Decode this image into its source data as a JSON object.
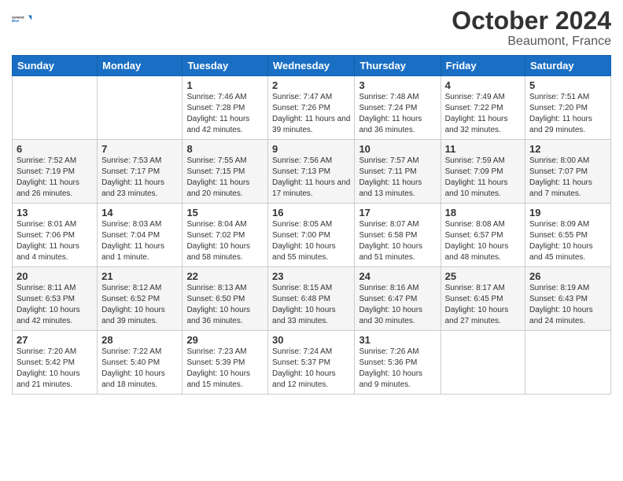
{
  "header": {
    "logo_general": "General",
    "logo_blue": "Blue",
    "month_title": "October 2024",
    "location": "Beaumont, France"
  },
  "days_of_week": [
    "Sunday",
    "Monday",
    "Tuesday",
    "Wednesday",
    "Thursday",
    "Friday",
    "Saturday"
  ],
  "weeks": [
    [
      {
        "day": "",
        "sunrise": "",
        "sunset": "",
        "daylight": ""
      },
      {
        "day": "",
        "sunrise": "",
        "sunset": "",
        "daylight": ""
      },
      {
        "day": "1",
        "sunrise": "Sunrise: 7:46 AM",
        "sunset": "Sunset: 7:28 PM",
        "daylight": "Daylight: 11 hours and 42 minutes."
      },
      {
        "day": "2",
        "sunrise": "Sunrise: 7:47 AM",
        "sunset": "Sunset: 7:26 PM",
        "daylight": "Daylight: 11 hours and 39 minutes."
      },
      {
        "day": "3",
        "sunrise": "Sunrise: 7:48 AM",
        "sunset": "Sunset: 7:24 PM",
        "daylight": "Daylight: 11 hours and 36 minutes."
      },
      {
        "day": "4",
        "sunrise": "Sunrise: 7:49 AM",
        "sunset": "Sunset: 7:22 PM",
        "daylight": "Daylight: 11 hours and 32 minutes."
      },
      {
        "day": "5",
        "sunrise": "Sunrise: 7:51 AM",
        "sunset": "Sunset: 7:20 PM",
        "daylight": "Daylight: 11 hours and 29 minutes."
      }
    ],
    [
      {
        "day": "6",
        "sunrise": "Sunrise: 7:52 AM",
        "sunset": "Sunset: 7:19 PM",
        "daylight": "Daylight: 11 hours and 26 minutes."
      },
      {
        "day": "7",
        "sunrise": "Sunrise: 7:53 AM",
        "sunset": "Sunset: 7:17 PM",
        "daylight": "Daylight: 11 hours and 23 minutes."
      },
      {
        "day": "8",
        "sunrise": "Sunrise: 7:55 AM",
        "sunset": "Sunset: 7:15 PM",
        "daylight": "Daylight: 11 hours and 20 minutes."
      },
      {
        "day": "9",
        "sunrise": "Sunrise: 7:56 AM",
        "sunset": "Sunset: 7:13 PM",
        "daylight": "Daylight: 11 hours and 17 minutes."
      },
      {
        "day": "10",
        "sunrise": "Sunrise: 7:57 AM",
        "sunset": "Sunset: 7:11 PM",
        "daylight": "Daylight: 11 hours and 13 minutes."
      },
      {
        "day": "11",
        "sunrise": "Sunrise: 7:59 AM",
        "sunset": "Sunset: 7:09 PM",
        "daylight": "Daylight: 11 hours and 10 minutes."
      },
      {
        "day": "12",
        "sunrise": "Sunrise: 8:00 AM",
        "sunset": "Sunset: 7:07 PM",
        "daylight": "Daylight: 11 hours and 7 minutes."
      }
    ],
    [
      {
        "day": "13",
        "sunrise": "Sunrise: 8:01 AM",
        "sunset": "Sunset: 7:06 PM",
        "daylight": "Daylight: 11 hours and 4 minutes."
      },
      {
        "day": "14",
        "sunrise": "Sunrise: 8:03 AM",
        "sunset": "Sunset: 7:04 PM",
        "daylight": "Daylight: 11 hours and 1 minute."
      },
      {
        "day": "15",
        "sunrise": "Sunrise: 8:04 AM",
        "sunset": "Sunset: 7:02 PM",
        "daylight": "Daylight: 10 hours and 58 minutes."
      },
      {
        "day": "16",
        "sunrise": "Sunrise: 8:05 AM",
        "sunset": "Sunset: 7:00 PM",
        "daylight": "Daylight: 10 hours and 55 minutes."
      },
      {
        "day": "17",
        "sunrise": "Sunrise: 8:07 AM",
        "sunset": "Sunset: 6:58 PM",
        "daylight": "Daylight: 10 hours and 51 minutes."
      },
      {
        "day": "18",
        "sunrise": "Sunrise: 8:08 AM",
        "sunset": "Sunset: 6:57 PM",
        "daylight": "Daylight: 10 hours and 48 minutes."
      },
      {
        "day": "19",
        "sunrise": "Sunrise: 8:09 AM",
        "sunset": "Sunset: 6:55 PM",
        "daylight": "Daylight: 10 hours and 45 minutes."
      }
    ],
    [
      {
        "day": "20",
        "sunrise": "Sunrise: 8:11 AM",
        "sunset": "Sunset: 6:53 PM",
        "daylight": "Daylight: 10 hours and 42 minutes."
      },
      {
        "day": "21",
        "sunrise": "Sunrise: 8:12 AM",
        "sunset": "Sunset: 6:52 PM",
        "daylight": "Daylight: 10 hours and 39 minutes."
      },
      {
        "day": "22",
        "sunrise": "Sunrise: 8:13 AM",
        "sunset": "Sunset: 6:50 PM",
        "daylight": "Daylight: 10 hours and 36 minutes."
      },
      {
        "day": "23",
        "sunrise": "Sunrise: 8:15 AM",
        "sunset": "Sunset: 6:48 PM",
        "daylight": "Daylight: 10 hours and 33 minutes."
      },
      {
        "day": "24",
        "sunrise": "Sunrise: 8:16 AM",
        "sunset": "Sunset: 6:47 PM",
        "daylight": "Daylight: 10 hours and 30 minutes."
      },
      {
        "day": "25",
        "sunrise": "Sunrise: 8:17 AM",
        "sunset": "Sunset: 6:45 PM",
        "daylight": "Daylight: 10 hours and 27 minutes."
      },
      {
        "day": "26",
        "sunrise": "Sunrise: 8:19 AM",
        "sunset": "Sunset: 6:43 PM",
        "daylight": "Daylight: 10 hours and 24 minutes."
      }
    ],
    [
      {
        "day": "27",
        "sunrise": "Sunrise: 7:20 AM",
        "sunset": "Sunset: 5:42 PM",
        "daylight": "Daylight: 10 hours and 21 minutes."
      },
      {
        "day": "28",
        "sunrise": "Sunrise: 7:22 AM",
        "sunset": "Sunset: 5:40 PM",
        "daylight": "Daylight: 10 hours and 18 minutes."
      },
      {
        "day": "29",
        "sunrise": "Sunrise: 7:23 AM",
        "sunset": "Sunset: 5:39 PM",
        "daylight": "Daylight: 10 hours and 15 minutes."
      },
      {
        "day": "30",
        "sunrise": "Sunrise: 7:24 AM",
        "sunset": "Sunset: 5:37 PM",
        "daylight": "Daylight: 10 hours and 12 minutes."
      },
      {
        "day": "31",
        "sunrise": "Sunrise: 7:26 AM",
        "sunset": "Sunset: 5:36 PM",
        "daylight": "Daylight: 10 hours and 9 minutes."
      },
      {
        "day": "",
        "sunrise": "",
        "sunset": "",
        "daylight": ""
      },
      {
        "day": "",
        "sunrise": "",
        "sunset": "",
        "daylight": ""
      }
    ]
  ]
}
